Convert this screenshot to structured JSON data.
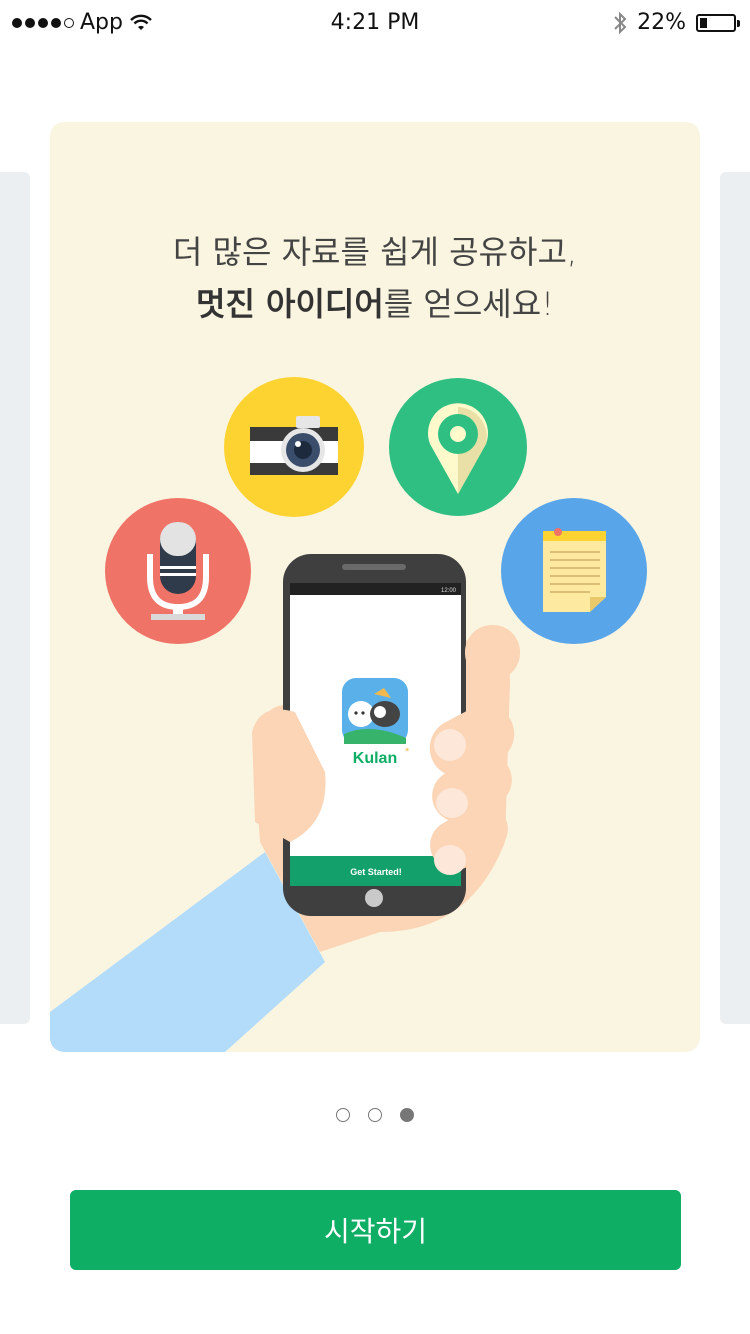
{
  "status_bar": {
    "carrier": "App",
    "time": "4:21 PM",
    "battery_percent": "22%",
    "battery_level": 0.22,
    "signal_bars": 4,
    "icons": [
      "signal-dots-icon",
      "wifi-icon",
      "bluetooth-icon",
      "battery-icon"
    ]
  },
  "onboarding": {
    "headline_line1": "더 많은 자료를 쉽게 공유하고,",
    "headline_bold": "멋진 아이디어",
    "headline_line2_rest": "를 얻으세요!",
    "illustration_icons": [
      "microphone-icon",
      "camera-icon",
      "location-pin-icon",
      "memo-icon"
    ],
    "phone_screen": {
      "app_name": "Kulan",
      "cta": "Get Started!",
      "status_time": "12:00"
    },
    "colors": {
      "card_background": "#faf5e1",
      "mic_circle": "#f07367",
      "camera_circle": "#fdd332",
      "pin_circle": "#2fbf82",
      "memo_circle": "#58a5ea",
      "brand_green": "#0eae64"
    }
  },
  "pager": {
    "total": 3,
    "active_index": 2
  },
  "start_button": {
    "label": "시작하기"
  }
}
